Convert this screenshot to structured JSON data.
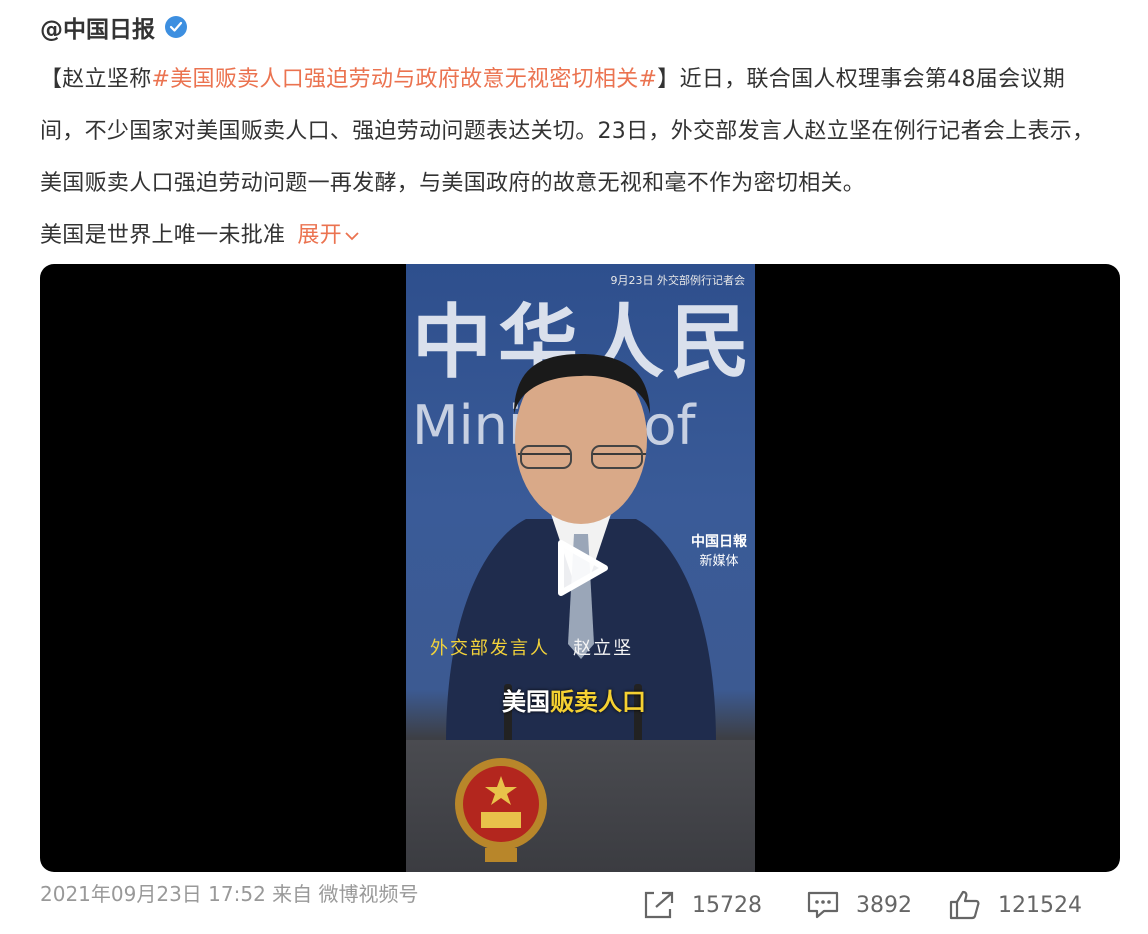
{
  "author": {
    "name": "@中国日报"
  },
  "post": {
    "lead_open": "【赵立坚称",
    "hashtag": "#美国贩卖人口强迫劳动与政府故意无视密切相关#",
    "lead_rest": "】近日，联合国人权理事会第48届会议期间，不少国家对美国贩卖人口、强迫劳动问题表达关切。23日，外交部发言人赵立坚在例行记者会上表示，美国贩卖人口强迫劳动问题一再发酵，与美国政府的故意无视和毫不作为密切相关。",
    "truncated": "美国是世界上唯一未批准",
    "expand_label": "展开"
  },
  "video": {
    "stamp": "9月23日 外交部例行记者会",
    "bg_title": "中华人民",
    "bg_ministry": "Ministry of",
    "logo_line1": "中国日報",
    "logo_line2": "新媒体",
    "subtitle_role": "外交部发言人",
    "subtitle_name": "赵立坚",
    "caption_white": "美国",
    "caption_yellow": "贩卖人口"
  },
  "meta": {
    "timestamp": "2021年09月23日 17:52",
    "source": "来自 微博视频号"
  },
  "actions": {
    "repost_count": "15728",
    "comment_count": "3892",
    "like_count": "121524"
  },
  "colors": {
    "accent": "#eb7350",
    "verified": "#3d8fe0"
  }
}
